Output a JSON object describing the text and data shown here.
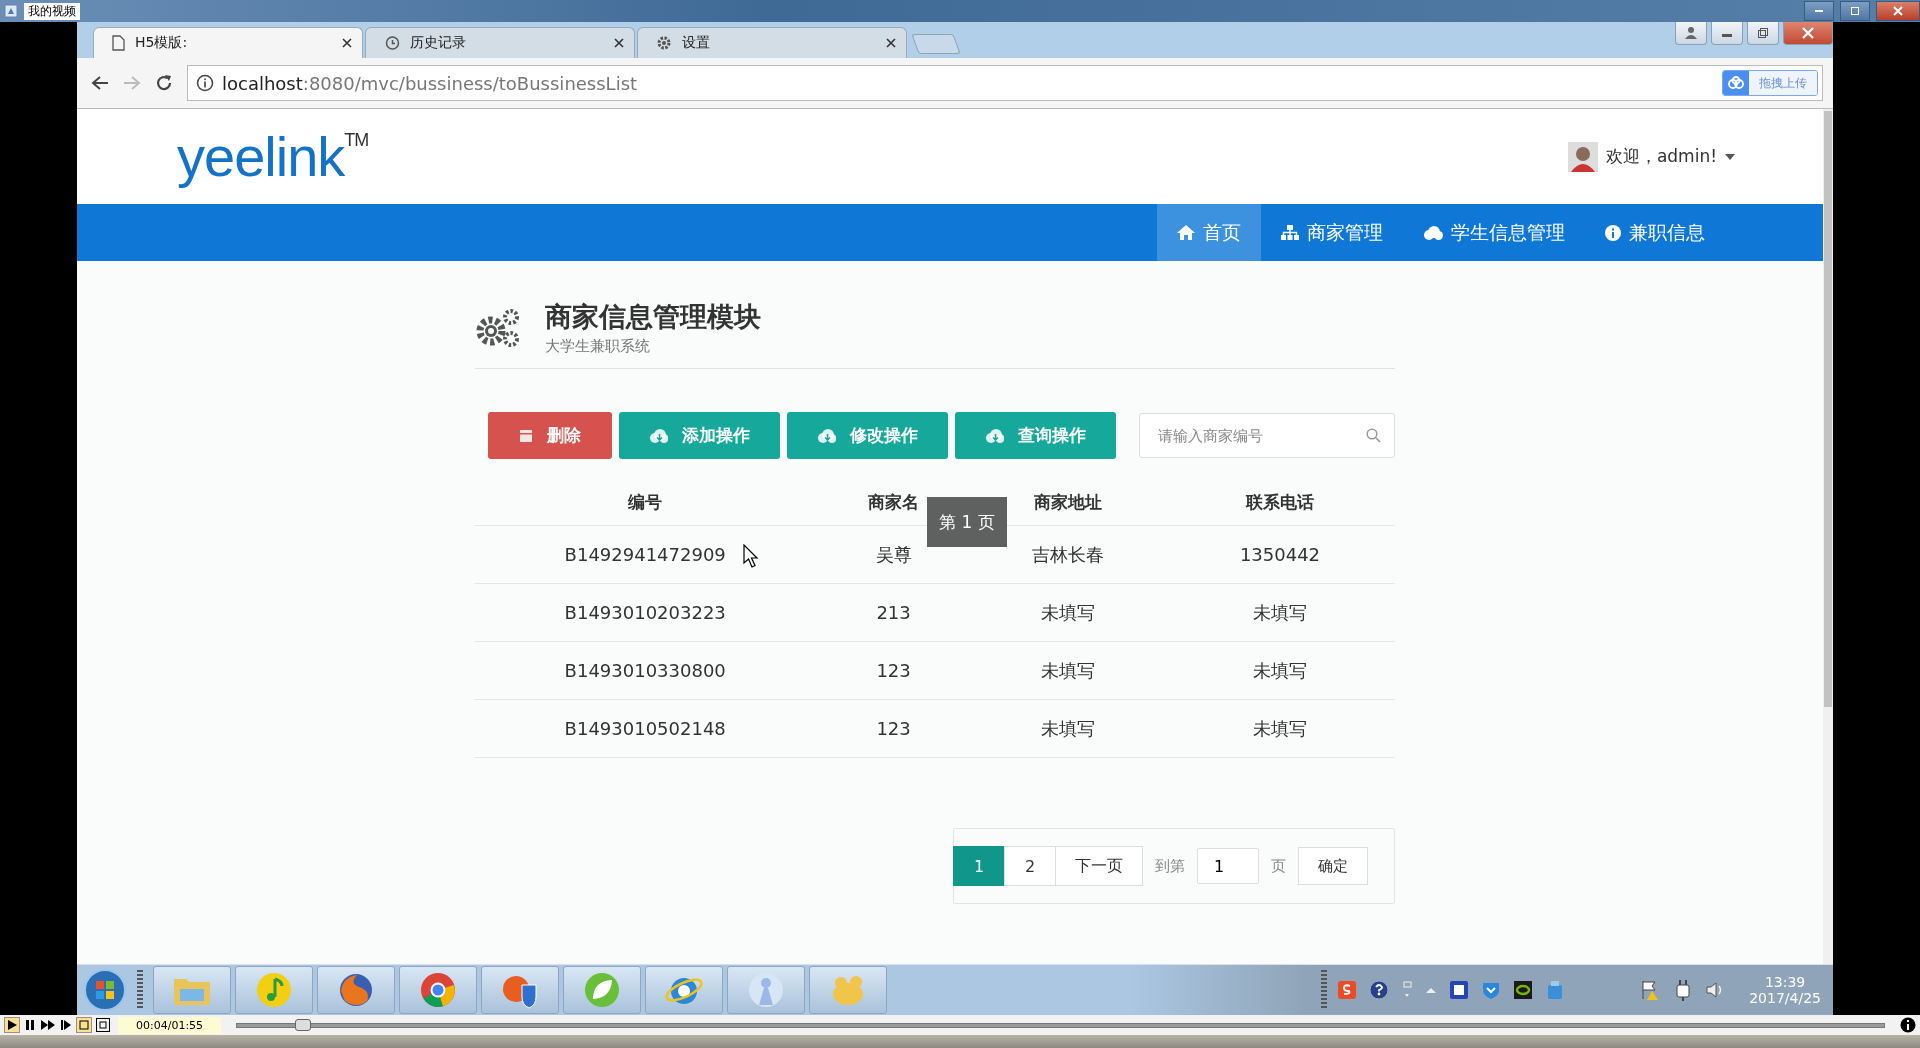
{
  "player": {
    "title": "我的视频",
    "time": "00:04/01:55",
    "level": 0.035
  },
  "browser": {
    "tabs": [
      {
        "title": "H5模版:",
        "kind": "page",
        "selected": true
      },
      {
        "title": "历史记录",
        "kind": "history",
        "selected": false
      },
      {
        "title": "设置",
        "kind": "settings",
        "selected": false
      }
    ],
    "url_host": "localhost",
    "url_path": ":8080/mvc/bussiness/toBussinessList",
    "extension": "拖拽上传"
  },
  "page": {
    "logo": "yeelink$^{TM}$",
    "user": "欢迎，admin!",
    "nav": [
      {
        "label": "首页",
        "kind": "home",
        "selected": true
      },
      {
        "label": "商家管理",
        "kind": "sitemap",
        "selected": false
      },
      {
        "label": "学生信息管理",
        "kind": "cloud",
        "selected": false
      },
      {
        "label": "兼职信息",
        "kind": "info",
        "selected": false
      }
    ],
    "heading": "商家信息管理模块",
    "subheading": "大学生兼职系统",
    "buttons": [
      {
        "label": "删除",
        "kind": "danger"
      },
      {
        "label": "添加操作",
        "kind": "primary"
      },
      {
        "label": "修改操作",
        "kind": "primary"
      },
      {
        "label": "查询操作",
        "kind": "primary"
      }
    ],
    "search": {
      "placeholder": "请输入商家编号"
    },
    "table": {
      "columns": [
        "编号",
        "商家名",
        "商家地址",
        "联系电话"
      ],
      "rows": [
        [
          "B1492941472909",
          "吴尊",
          "吉林长春",
          "1350442"
        ],
        [
          "B1493010203223",
          "213",
          "未填写",
          "未填写"
        ],
        [
          "B1493010330800",
          "123",
          "未填写",
          "未填写"
        ],
        [
          "B1493010502148",
          "123",
          "未填写",
          "未填写"
        ]
      ]
    },
    "tooltip": "第 1 页",
    "pagination": {
      "pages": [
        {
          "label": "1",
          "selected": true
        },
        {
          "label": "2",
          "selected": false
        }
      ],
      "next": "下一页",
      "goto_label": "到第",
      "goto_value": "1",
      "unit": "页",
      "confirm": "确定"
    }
  },
  "taskbar": {
    "time": "13:39",
    "date": "2017/4/25"
  }
}
